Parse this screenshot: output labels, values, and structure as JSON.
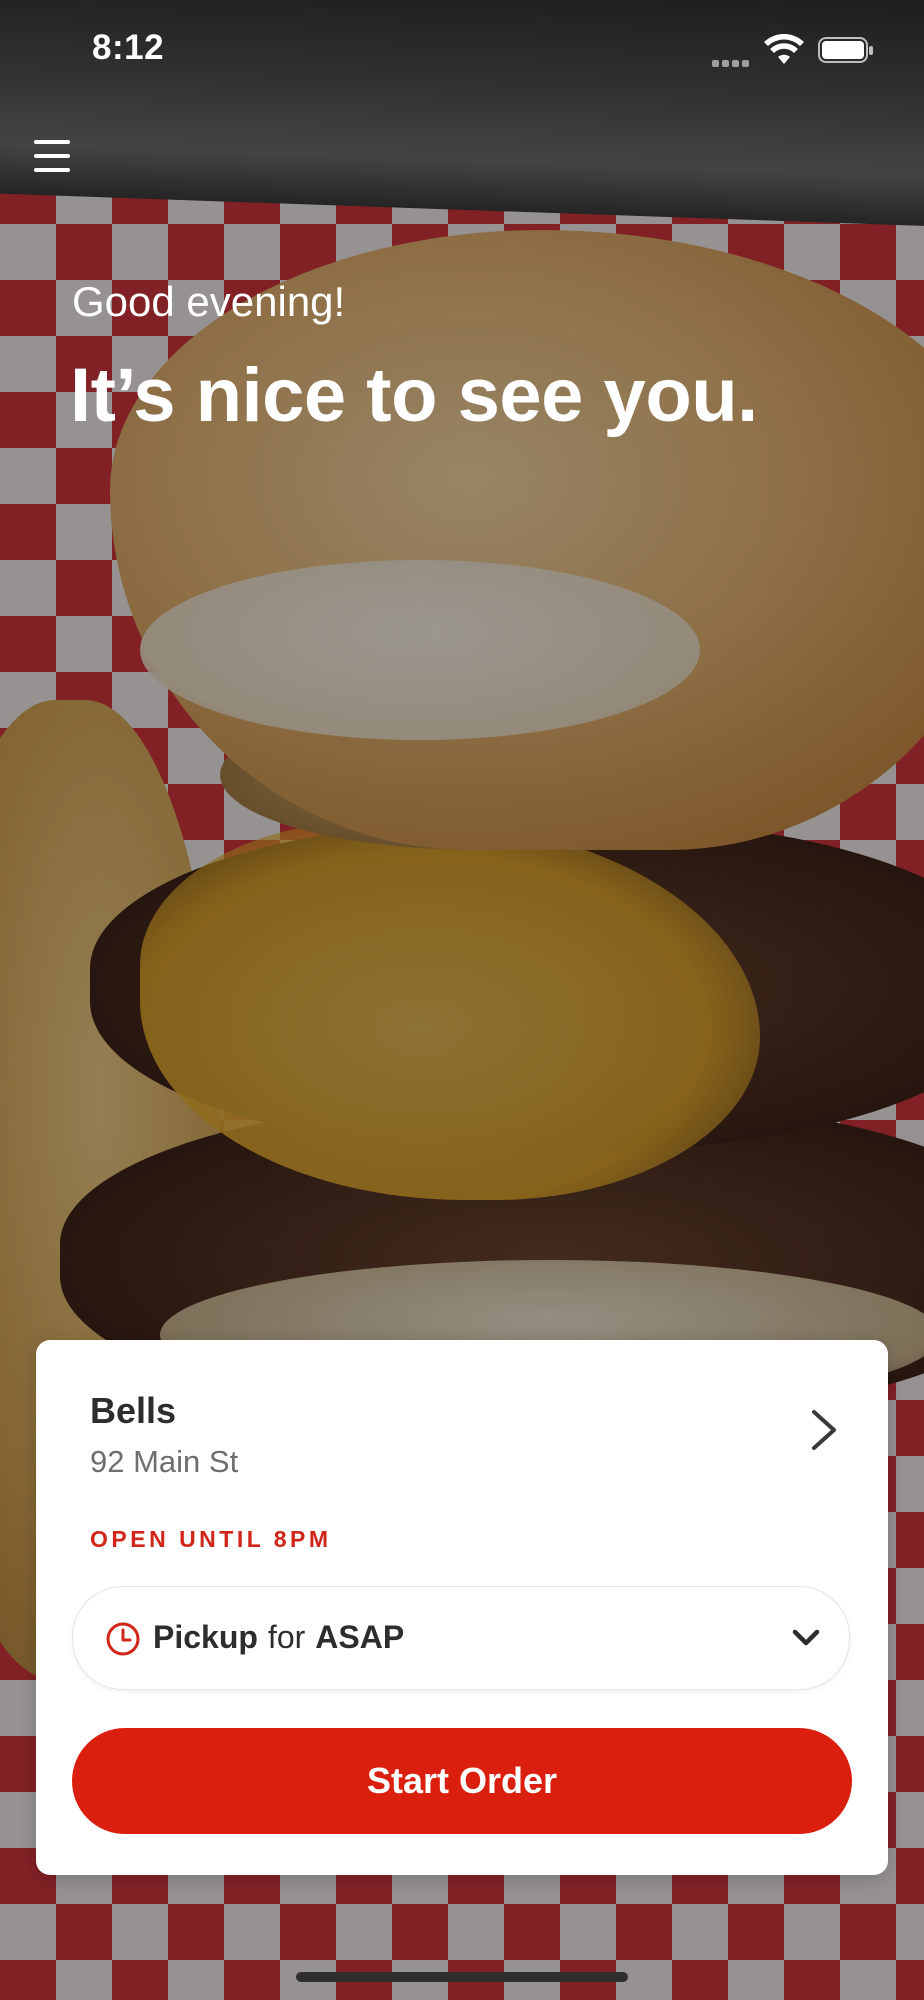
{
  "status_bar": {
    "time": "8:12"
  },
  "header": {
    "menu_icon": "hamburger-menu-icon",
    "greeting": "Good evening!",
    "headline": "It’s nice to see you."
  },
  "store_card": {
    "store_name": "Bells",
    "address": "92 Main St",
    "open_status": "OPEN UNTIL 8PM",
    "order_mode": {
      "mode": "Pickup",
      "connector": "for",
      "time": "ASAP",
      "icon": "clock-icon"
    },
    "start_order_label": "Start Order"
  },
  "colors": {
    "accent": "#da1f0e",
    "open_status": "#d0261a",
    "text_primary": "#2d2d2d",
    "text_secondary": "#6e6e6e"
  }
}
